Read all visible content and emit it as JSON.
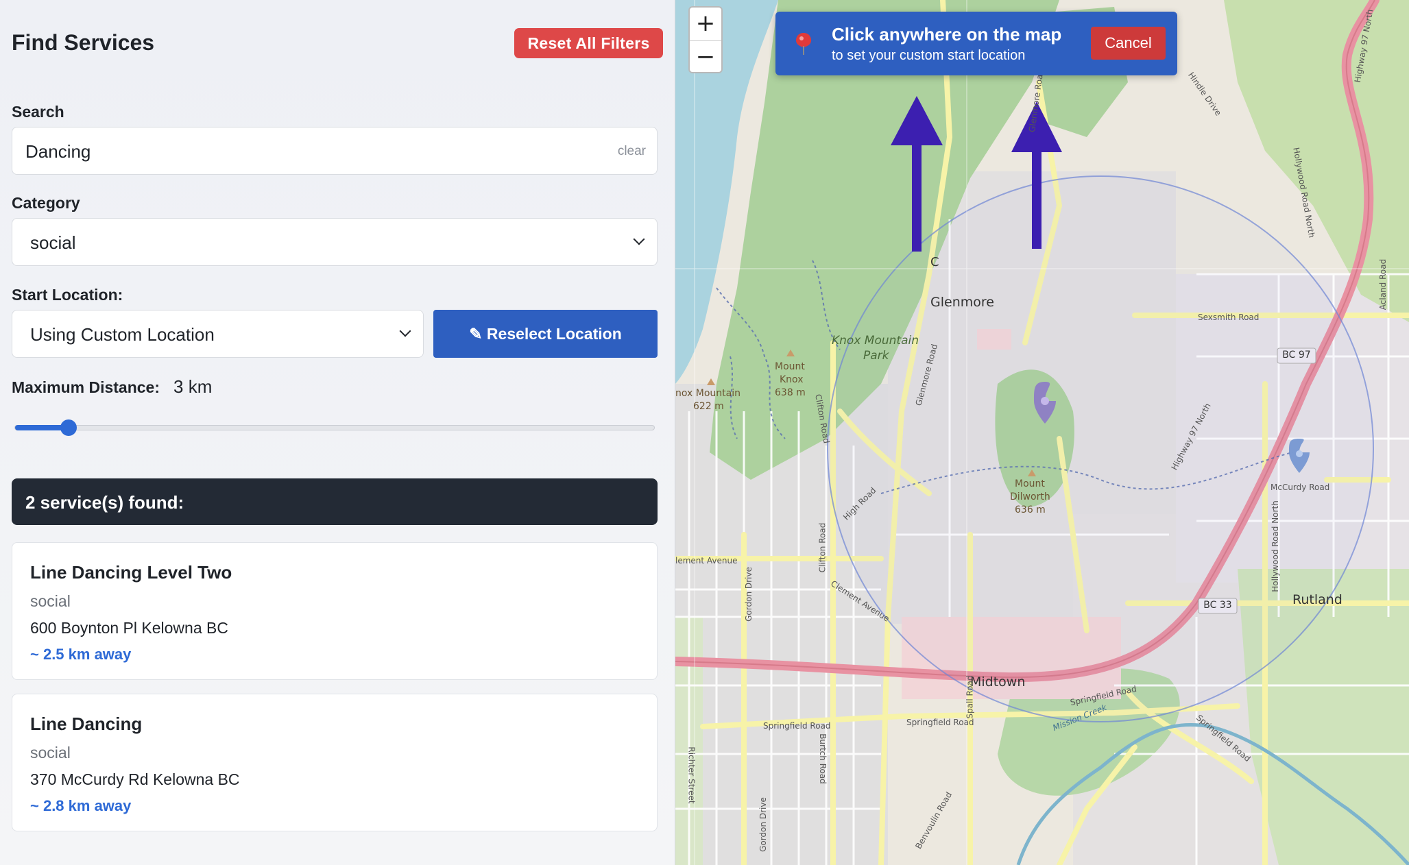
{
  "sidebar": {
    "title": "Find Services",
    "reset_label": "Reset All Filters",
    "search": {
      "label": "Search",
      "value": "Dancing",
      "clear_label": "clear"
    },
    "category": {
      "label": "Category",
      "value": "social"
    },
    "start_location": {
      "label": "Start Location:",
      "value": "Using Custom Location",
      "reselect_label": "✎ Reselect Location"
    },
    "distance": {
      "label": "Maximum Distance:",
      "value": "3 km",
      "km": 3,
      "min_km": 1,
      "max_km": 25
    },
    "results": {
      "summary": "2 service(s) found:",
      "items": [
        {
          "title": "Line Dancing Level Two",
          "category": "social",
          "address": "600 Boynton Pl Kelowna BC",
          "distance": "~ 2.5 km away"
        },
        {
          "title": "Line Dancing",
          "category": "social",
          "address": "370 McCurdy Rd Kelowna BC",
          "distance": "~ 2.8 km away"
        }
      ]
    }
  },
  "map": {
    "zoom_in": "+",
    "zoom_out": "−",
    "toast": {
      "title": "Click anywhere on the map",
      "subtitle": "to set your custom start location",
      "cancel_label": "Cancel"
    },
    "labels": {
      "glenmore": "Glenmore",
      "knox_park": "Knox Mountain",
      "knox_park_2": "Park",
      "mount_knox": "Mount",
      "mount_knox_2": "Knox",
      "mount_knox_3": "638 m",
      "knox_mountain_west": "nox Mountain",
      "knox_mountain_west_2": "622 m",
      "mount_dilworth": "Mount",
      "mount_dilworth_2": "Dilworth",
      "mount_dilworth_3": "636 m",
      "midtown": "Midtown",
      "rutland": "Rutland",
      "bc97": "BC 97",
      "bc33": "BC 33",
      "sexsmith": "Sexsmith Road",
      "mccurdy": "McCurdy Road",
      "clement": "lement Avenue",
      "clement_ave": "Clement Avenue",
      "springfield": "Springfield Road",
      "springfield_2": "Springfield Road",
      "springfield_3": "Springfield Road",
      "springfield_4": "Springfield Road",
      "highway97": "Highway 97 North",
      "highway97_top": "Highway 97 North",
      "glenmore_road": "Glenmore Road",
      "glenmore_road_n": "Glenmore Road",
      "clifton": "Clifton Road",
      "clifton_2": "Clifton Road",
      "high_road": "High Road",
      "gordon": "Gordon Drive",
      "gordon_2": "Gordon Drive",
      "spall": "Spall Road",
      "burtch": "Burtch Road",
      "richter": "Richter Street",
      "benvoulin": "Benvoulin Road",
      "hollywood": "Hollywood Road North",
      "hollywood_2": "Hollywood Road North",
      "acland": "Acland Road",
      "hindle": "Hindle Drive",
      "mission_creek": "Mission Creek",
      "c_marker": "C"
    },
    "colors": {
      "toast_bg": "#2e5fc0",
      "cancel_bg": "#cd3a3a",
      "arrow": "#3c1fb0",
      "park": "#add19e",
      "water": "#aad3df",
      "highway": "#e892a2"
    }
  }
}
